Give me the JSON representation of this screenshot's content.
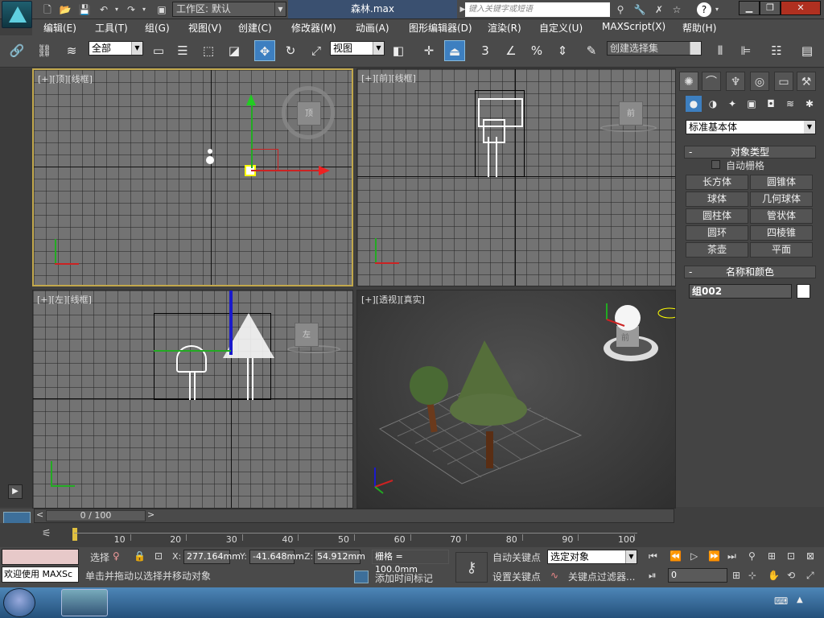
{
  "titlebar": {
    "workspace_label": "工作区: 默认",
    "doc_title": "森林.max",
    "search_placeholder": "键入关键字或短语",
    "help": "?"
  },
  "menu": [
    "编辑(E)",
    "工具(T)",
    "组(G)",
    "视图(V)",
    "创建(C)",
    "修改器(M)",
    "动画(A)",
    "图形编辑器(D)",
    "渲染(R)",
    "自定义(U)",
    "MAXScript(X)",
    "帮助(H)"
  ],
  "toolbar": {
    "filter_value": "全部",
    "refcoord_value": "视图",
    "snap_label": "3",
    "percent_label": "%",
    "named_sel_value": "创建选择集"
  },
  "viewports": {
    "top": {
      "label": "[+][顶][线框]",
      "cube": "顶"
    },
    "front": {
      "label": "[+][前][线框]",
      "cube": "前"
    },
    "left": {
      "label": "[+][左][线框]",
      "cube": "左"
    },
    "persp": {
      "label": "[+][透视][真实]",
      "cube": "前"
    }
  },
  "command_panel": {
    "category_value": "标准基本体",
    "object_type_title": "对象类型",
    "autogrid_label": "自动栅格",
    "object_buttons": [
      "长方体",
      "圆锥体",
      "球体",
      "几何球体",
      "圆柱体",
      "管状体",
      "圆环",
      "四棱锥",
      "茶壶",
      "平面"
    ],
    "name_color_title": "名称和颜色",
    "object_name": "组002",
    "object_color": "#ffffff"
  },
  "timeline": {
    "slider_label": "0 / 100",
    "ticks": [
      10,
      20,
      30,
      40,
      50,
      60,
      70,
      80,
      90,
      100
    ]
  },
  "status": {
    "maxscript_listener": "欢迎使用 MAXSc",
    "selection_label": "选择",
    "prompt": "单击并拖动以选择并移动对象",
    "x_label": "X:",
    "x_value": "277.164mm",
    "y_label": "Y:",
    "y_value": "-41.648mm",
    "z_label": "Z:",
    "z_value": "54.912mm",
    "grid_label": "栅格 = 100.0mm",
    "add_time_tag": "添加时间标记",
    "autokey_label": "自动关键点",
    "setkey_label": "设置关键点",
    "selected_value": "选定对象",
    "key_filters_label": "关键点过滤器...",
    "frame_value": "0"
  }
}
